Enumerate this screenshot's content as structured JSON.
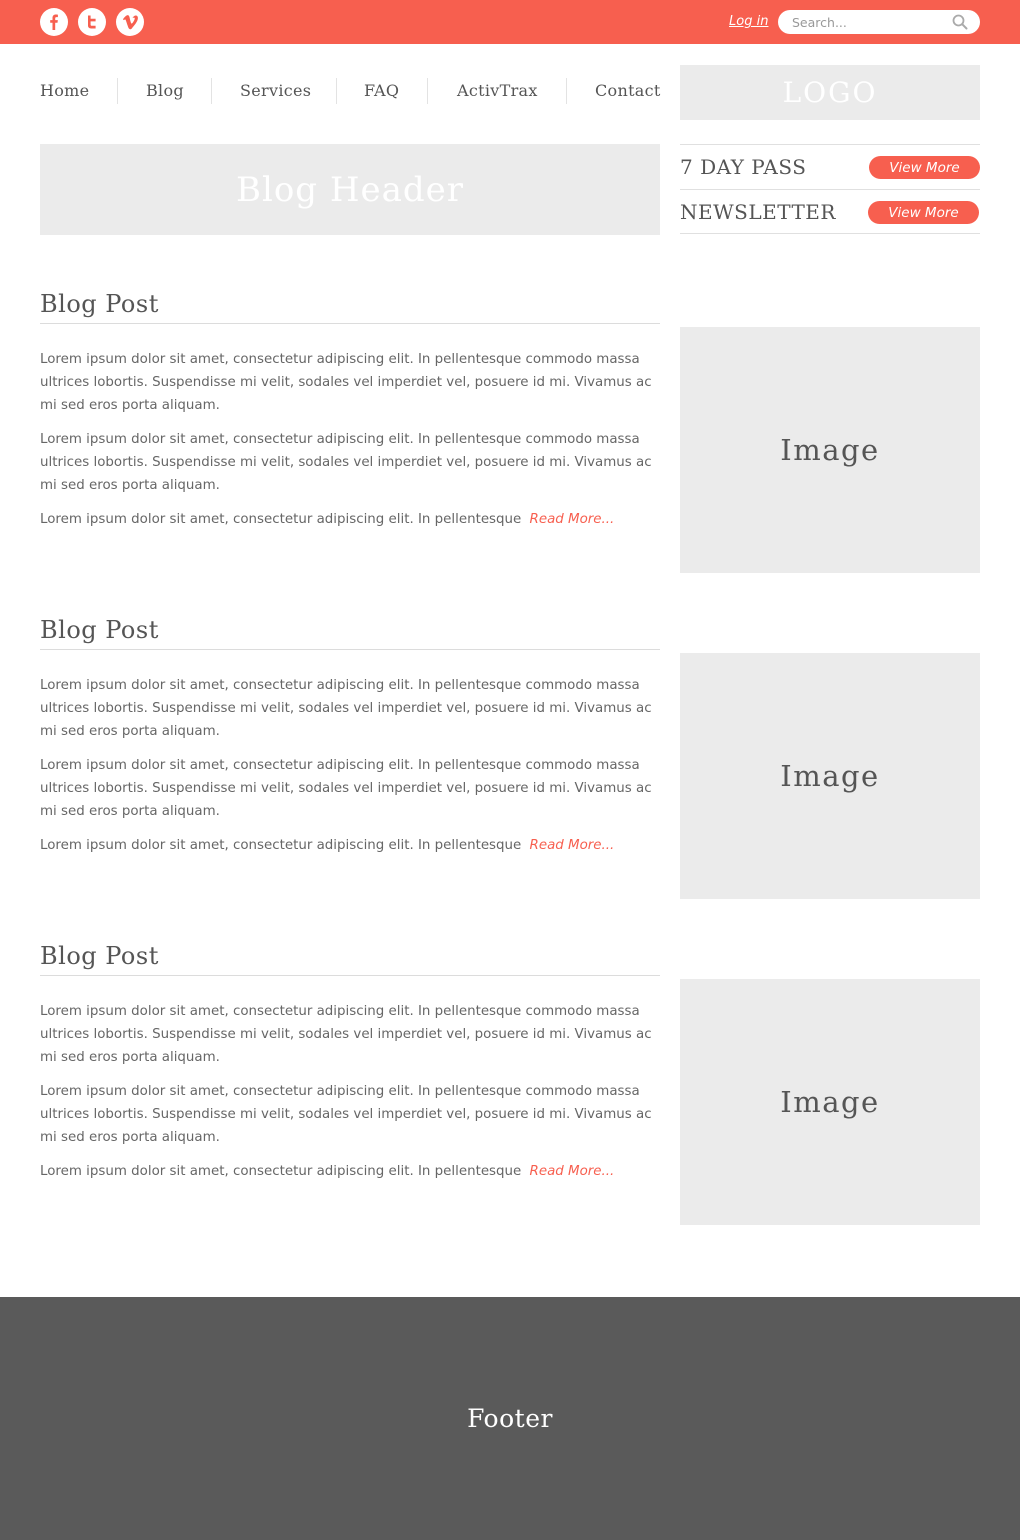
{
  "colors": {
    "accent": "#f75f4f",
    "placeholder_bg": "#ebebeb",
    "footer_bg": "#5a5a5a"
  },
  "topbar": {
    "social": [
      {
        "icon": "facebook-icon"
      },
      {
        "icon": "twitter-icon"
      },
      {
        "icon": "vimeo-icon"
      }
    ],
    "login_label": "Log in",
    "search_placeholder": "Search..."
  },
  "nav": {
    "items": [
      "Home",
      "Blog",
      "Services",
      "FAQ",
      "ActivTrax",
      "Contact"
    ]
  },
  "logo": "LOGO",
  "blog_header": "Blog Header",
  "promos": [
    {
      "title": "7 DAY PASS",
      "button": "View More"
    },
    {
      "title": "NEWSLETTER",
      "button": "View More"
    }
  ],
  "posts": [
    {
      "title": "Blog Post",
      "para1": "Lorem ipsum dolor sit amet, consectetur adipiscing elit. In pellentesque commodo massa ultrices lobortis. Suspendisse mi velit, sodales vel imperdiet vel, posuere id mi. Vivamus ac mi sed eros porta aliquam.",
      "para2": "Lorem ipsum dolor sit amet, consectetur adipiscing elit. In pellentesque commodo massa ultrices lobortis. Suspendisse mi velit, sodales vel imperdiet vel, posuere id mi. Vivamus ac mi sed eros porta aliquam.",
      "teaser": "Lorem ipsum dolor sit amet, consectetur adipiscing elit. In pellentesque",
      "read_more": "Read More...",
      "image_label": "Image"
    },
    {
      "title": "Blog Post",
      "para1": "Lorem ipsum dolor sit amet, consectetur adipiscing elit. In pellentesque commodo massa ultrices lobortis. Suspendisse mi velit, sodales vel imperdiet vel, posuere id mi. Vivamus ac mi sed eros porta aliquam.",
      "para2": "Lorem ipsum dolor sit amet, consectetur adipiscing elit. In pellentesque commodo massa ultrices lobortis. Suspendisse mi velit, sodales vel imperdiet vel, posuere id mi. Vivamus ac mi sed eros porta aliquam.",
      "teaser": "Lorem ipsum dolor sit amet, consectetur adipiscing elit. In pellentesque",
      "read_more": "Read More...",
      "image_label": "Image"
    },
    {
      "title": "Blog Post",
      "para1": "Lorem ipsum dolor sit amet, consectetur adipiscing elit. In pellentesque commodo massa ultrices lobortis. Suspendisse mi velit, sodales vel imperdiet vel, posuere id mi. Vivamus ac mi sed eros porta aliquam.",
      "para2": "Lorem ipsum dolor sit amet, consectetur adipiscing elit. In pellentesque commodo massa ultrices lobortis. Suspendisse mi velit, sodales vel imperdiet vel, posuere id mi. Vivamus ac mi sed eros porta aliquam.",
      "teaser": "Lorem ipsum dolor sit amet, consectetur adipiscing elit. In pellentesque",
      "read_more": "Read More...",
      "image_label": "Image"
    }
  ],
  "footer": "Footer"
}
